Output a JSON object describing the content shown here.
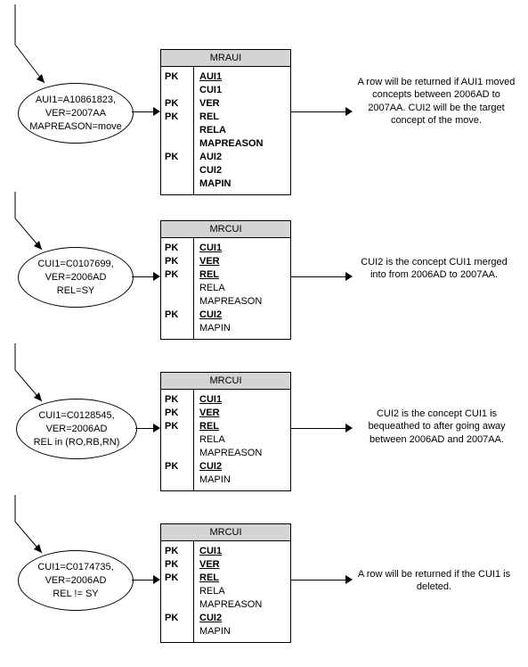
{
  "rows": [
    {
      "ellipse": {
        "lines": [
          "AUI1=A10861823,",
          "VER=2007AA",
          "MAPREASON=move"
        ]
      },
      "table": {
        "title": "MRAUI",
        "fields": [
          {
            "pk": "PK",
            "name": "AUI1",
            "bold": true,
            "ul": true
          },
          {
            "pk": "",
            "name": "CUI1",
            "bold": true,
            "ul": false
          },
          {
            "pk": "PK",
            "name": "VER",
            "bold": true,
            "ul": false
          },
          {
            "pk": "PK",
            "name": "REL",
            "bold": true,
            "ul": false
          },
          {
            "pk": "",
            "name": "RELA",
            "bold": true,
            "ul": false
          },
          {
            "pk": "",
            "name": "MAPREASON",
            "bold": true,
            "ul": false
          },
          {
            "pk": "PK",
            "name": "AUI2",
            "bold": true,
            "ul": false
          },
          {
            "pk": "",
            "name": "CUI2",
            "bold": true,
            "ul": false
          },
          {
            "pk": "",
            "name": "MAPIN",
            "bold": true,
            "ul": false
          }
        ]
      },
      "desc": "A row will be returned if AUI1 moved concepts between 2006AD to 2007AA.  CUI2 will be the target concept of the move."
    },
    {
      "ellipse": {
        "lines": [
          "CUI1=C0107699,",
          "VER=2006AD",
          "REL=SY"
        ]
      },
      "table": {
        "title": "MRCUI",
        "fields": [
          {
            "pk": "PK",
            "name": "CUI1",
            "bold": true,
            "ul": true
          },
          {
            "pk": "PK",
            "name": "VER",
            "bold": true,
            "ul": true
          },
          {
            "pk": "PK",
            "name": "REL",
            "bold": true,
            "ul": true
          },
          {
            "pk": "",
            "name": "RELA",
            "bold": false,
            "ul": false
          },
          {
            "pk": "",
            "name": "MAPREASON",
            "bold": false,
            "ul": false
          },
          {
            "pk": "PK",
            "name": "CUI2",
            "bold": true,
            "ul": true
          },
          {
            "pk": "",
            "name": "MAPIN",
            "bold": false,
            "ul": false
          }
        ]
      },
      "desc": "CUI2 is the concept CUI1 merged into from 2006AD to 2007AA."
    },
    {
      "ellipse": {
        "lines": [
          "CUI1=C0128545,",
          "VER=2006AD",
          "REL in (RO,RB,RN)"
        ]
      },
      "table": {
        "title": "MRCUI",
        "fields": [
          {
            "pk": "PK",
            "name": "CUI1",
            "bold": true,
            "ul": true
          },
          {
            "pk": "PK",
            "name": "VER",
            "bold": true,
            "ul": true
          },
          {
            "pk": "PK",
            "name": "REL",
            "bold": true,
            "ul": true
          },
          {
            "pk": "",
            "name": "RELA",
            "bold": false,
            "ul": false
          },
          {
            "pk": "",
            "name": "MAPREASON",
            "bold": false,
            "ul": false
          },
          {
            "pk": "PK",
            "name": "CUI2",
            "bold": true,
            "ul": true
          },
          {
            "pk": "",
            "name": "MAPIN",
            "bold": false,
            "ul": false
          }
        ]
      },
      "desc": "CUI2 is the concept CUI1 is bequeathed to after going away between 2006AD and 2007AA."
    },
    {
      "ellipse": {
        "lines": [
          "CUI1=C0174735,",
          "VER=2006AD",
          "REL != SY"
        ]
      },
      "table": {
        "title": "MRCUI",
        "fields": [
          {
            "pk": "PK",
            "name": "CUI1",
            "bold": true,
            "ul": true
          },
          {
            "pk": "PK",
            "name": "VER",
            "bold": true,
            "ul": true
          },
          {
            "pk": "PK",
            "name": "REL",
            "bold": true,
            "ul": true
          },
          {
            "pk": "",
            "name": "RELA",
            "bold": false,
            "ul": false
          },
          {
            "pk": "",
            "name": "MAPREASON",
            "bold": false,
            "ul": false
          },
          {
            "pk": "PK",
            "name": "CUI2",
            "bold": true,
            "ul": true
          },
          {
            "pk": "",
            "name": "MAPIN",
            "bold": false,
            "ul": false
          }
        ]
      },
      "desc": "A row will be returned if the CUI1 is deleted."
    }
  ]
}
